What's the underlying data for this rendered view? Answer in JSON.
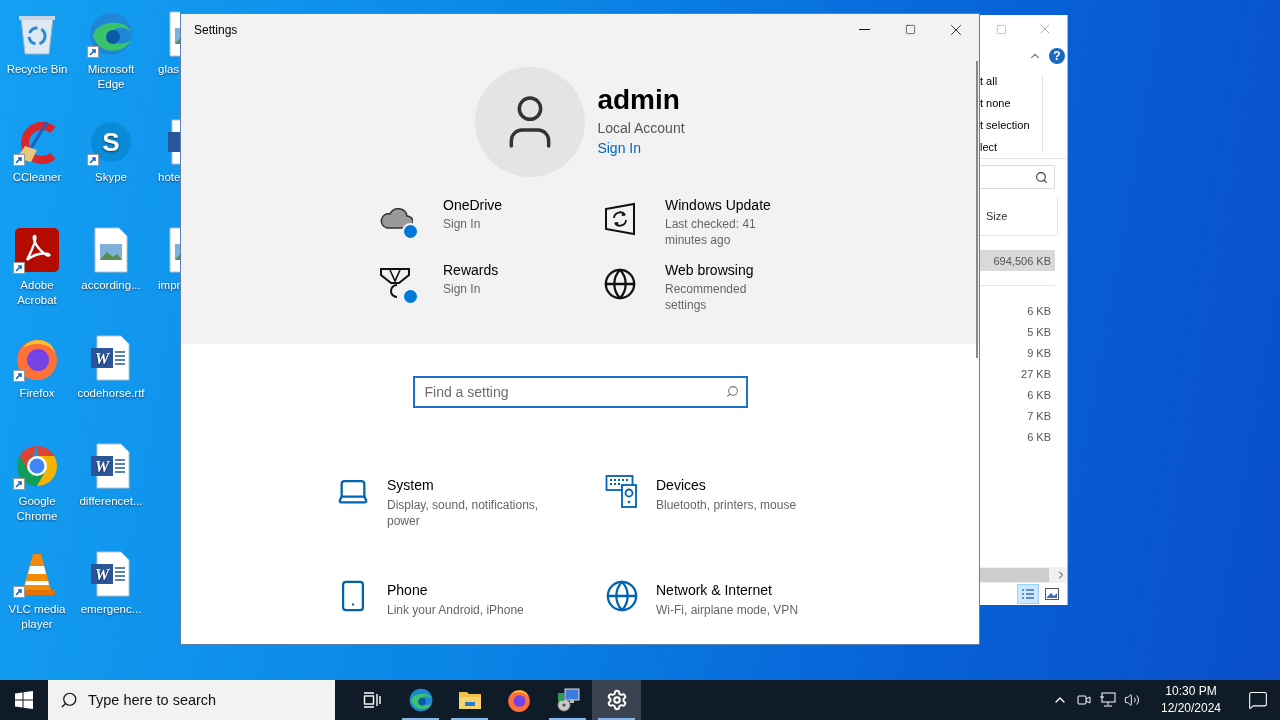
{
  "desktop_icons": [
    {
      "label": "Recycle Bin",
      "kind": "recycle",
      "shortcut": false
    },
    {
      "label": "CCleaner",
      "kind": "cleaner",
      "shortcut": true
    },
    {
      "label": "Adobe Acrobat",
      "kind": "pdf",
      "shortcut": true
    },
    {
      "label": "Firefox",
      "kind": "firefox",
      "shortcut": true
    },
    {
      "label": "Google Chrome",
      "kind": "chrome",
      "shortcut": true
    },
    {
      "label": "VLC media player",
      "kind": "cone",
      "shortcut": true
    },
    {
      "label": "Microsoft Edge",
      "kind": "edge",
      "shortcut": true
    },
    {
      "label": "Skype",
      "kind": "chat",
      "shortcut": true,
      "glyph": "S"
    },
    {
      "label": "according...",
      "kind": "image",
      "shortcut": false
    },
    {
      "label": "codehorse.rtf",
      "kind": "word",
      "shortcut": false,
      "glyph": "W"
    },
    {
      "label": "differencet...",
      "kind": "word",
      "shortcut": false,
      "glyph": "W"
    },
    {
      "label": "emergenc...",
      "kind": "word",
      "shortcut": false,
      "glyph": "W"
    },
    {
      "label": "glas",
      "kind": "image",
      "shortcut": false
    },
    {
      "label": "hote",
      "kind": "word",
      "shortcut": false
    },
    {
      "label": "impr",
      "kind": "image",
      "shortcut": false
    }
  ],
  "explorer_window": {
    "help": "?",
    "ribbon_items": [
      "t all",
      "t none",
      "t selection",
      "lect"
    ],
    "column": "Size",
    "groups": [
      {
        "rows": [
          {
            "size": "694,506 KB",
            "selected": true
          }
        ]
      },
      {
        "rows": [
          {
            "size": "6 KB",
            "selected": false
          },
          {
            "size": "5 KB",
            "selected": false
          },
          {
            "size": "9 KB",
            "selected": false
          },
          {
            "size": "27 KB",
            "selected": false
          },
          {
            "size": "6 KB",
            "selected": false
          },
          {
            "size": "7 KB",
            "selected": false
          },
          {
            "size": "6 KB",
            "selected": false
          }
        ]
      }
    ],
    "views": [
      {
        "kind": "details",
        "selected": true
      },
      {
        "kind": "preview",
        "selected": false
      }
    ]
  },
  "settings_window": {
    "title": "Settings",
    "account": {
      "name": "admin",
      "type": "Local Account",
      "link": "Sign In"
    },
    "services": [
      {
        "kind": "cloud",
        "title": "OneDrive",
        "subtitle": "Sign In",
        "badge": true
      },
      {
        "kind": "update",
        "title": "Windows Update",
        "subtitle": "Last checked: 41 minutes ago",
        "badge": false
      },
      {
        "kind": "medal",
        "title": "Rewards",
        "subtitle": "Sign In",
        "badge": true
      },
      {
        "kind": "globe",
        "title": "Web browsing",
        "subtitle": "Recommended settings",
        "badge": false
      }
    ],
    "search": {
      "placeholder": "Find a setting"
    },
    "categories": [
      {
        "kind": "laptop",
        "title": "System",
        "description": "Display, sound, notifications, power"
      },
      {
        "kind": "devices",
        "title": "Devices",
        "description": "Bluetooth, printers, mouse"
      },
      {
        "kind": "phone",
        "title": "Phone",
        "description": "Link your Android, iPhone"
      },
      {
        "kind": "globe",
        "title": "Network & Internet",
        "description": "Wi-Fi, airplane mode, VPN"
      }
    ]
  },
  "taskbar": {
    "search_placeholder": "Type here to search",
    "apps": [
      {
        "kind": "edge",
        "running": true,
        "selected": false
      },
      {
        "kind": "folder",
        "running": true,
        "selected": false
      },
      {
        "kind": "firefox",
        "running": false,
        "selected": false
      },
      {
        "kind": "installer",
        "running": true,
        "selected": false
      },
      {
        "kind": "gear",
        "running": true,
        "selected": true
      }
    ],
    "time": "10:30 PM",
    "date": "12/20/2024"
  }
}
